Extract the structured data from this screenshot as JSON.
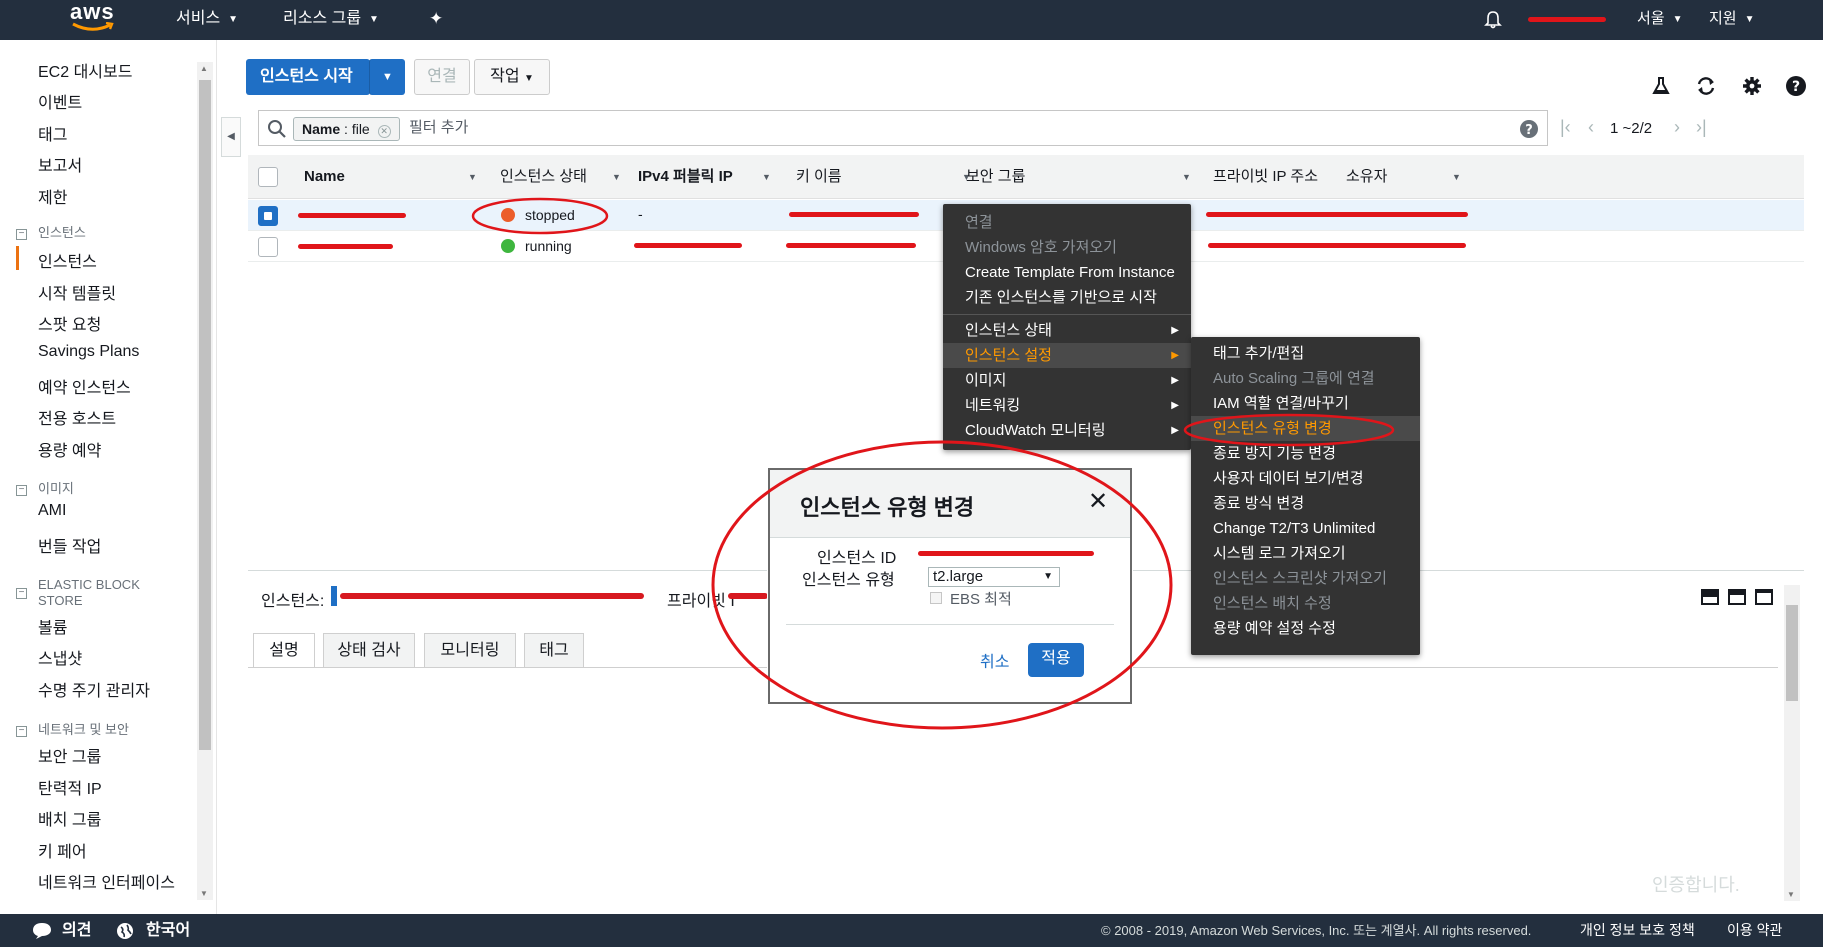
{
  "topnav": {
    "logo": "aws",
    "services": "서비스",
    "resource_groups": "리소스 그룹",
    "region": "서울",
    "support": "지원"
  },
  "sidebar": {
    "items_top": [
      "EC2 대시보드",
      "이벤트",
      "태그",
      "보고서",
      "제한"
    ],
    "sections": [
      {
        "title": "인스턴스",
        "items": [
          "인스턴스",
          "시작 템플릿",
          "스팟 요청",
          "Savings Plans",
          "예약 인스턴스",
          "전용 호스트",
          "용량 예약"
        ]
      },
      {
        "title": "이미지",
        "items": [
          "AMI",
          "번들 작업"
        ]
      },
      {
        "title": "ELASTIC BLOCK STORE",
        "title_line1": "ELASTIC BLOCK",
        "title_line2": "STORE",
        "items": [
          "볼륨",
          "스냅샷",
          "수명 주기 관리자"
        ]
      },
      {
        "title": "네트워크 및 보안",
        "items": [
          "보안 그룹",
          "탄력적 IP",
          "배치 그룹",
          "키 페어",
          "네트워크 인터페이스"
        ]
      }
    ],
    "active": "인스턴스"
  },
  "toolbar": {
    "launch_label": "인스턴스 시작",
    "connect_label": "연결",
    "actions_label": "작업"
  },
  "filter": {
    "chip_key": "Name",
    "chip_value": "file",
    "placeholder": "필터 추가",
    "pagination": "1 ~2/2"
  },
  "table": {
    "columns": [
      "Name",
      "인스턴스 상태",
      "IPv4 퍼블릭 IP",
      "키 이름",
      "보안 그룹",
      "프라이빗 IP 주소",
      "소유자"
    ],
    "rows": [
      {
        "state": "stopped",
        "state_color": "#ec5d2a",
        "ipv4": "-",
        "selected": true
      },
      {
        "state": "running",
        "state_color": "#3eb63e",
        "ipv4": "",
        "selected": false
      }
    ]
  },
  "context_menu": {
    "items": [
      {
        "label": "연결",
        "disabled": true
      },
      {
        "label": "Windows 암호 가져오기",
        "disabled": true
      },
      {
        "label": "Create Template From Instance",
        "disabled": false
      },
      {
        "label": "기존 인스턴스를 기반으로 시작",
        "disabled": false
      },
      {
        "label": "인스턴스 상태",
        "disabled": false,
        "submenu": true
      },
      {
        "label": "인스턴스 설정",
        "disabled": false,
        "submenu": true,
        "highlighted": true
      },
      {
        "label": "이미지",
        "disabled": false,
        "submenu": true
      },
      {
        "label": "네트워킹",
        "disabled": false,
        "submenu": true
      },
      {
        "label": "CloudWatch 모니터링",
        "disabled": false,
        "submenu": true
      }
    ]
  },
  "submenu": {
    "items": [
      {
        "label": "태그 추가/편집",
        "disabled": false
      },
      {
        "label": "Auto Scaling 그룹에 연결",
        "disabled": true
      },
      {
        "label": "IAM 역할 연결/바꾸기",
        "disabled": false
      },
      {
        "label": "인스턴스 유형 변경",
        "disabled": false,
        "highlighted": true
      },
      {
        "label": "종료 방지 기능 변경",
        "disabled": false
      },
      {
        "label": "사용자 데이터 보기/변경",
        "disabled": false
      },
      {
        "label": "종료 방식 변경",
        "disabled": false
      },
      {
        "label": "Change T2/T3 Unlimited",
        "disabled": false
      },
      {
        "label": "시스템 로그 가져오기",
        "disabled": false
      },
      {
        "label": "인스턴스 스크린샷 가져오기",
        "disabled": true
      },
      {
        "label": "인스턴스 배치 수정",
        "disabled": true
      },
      {
        "label": "용량 예약 설정 수정",
        "disabled": false
      }
    ]
  },
  "modal": {
    "title": "인스턴스 유형 변경",
    "instance_id_label": "인스턴스 ID",
    "instance_type_label": "인스턴스 유형",
    "instance_type_value": "t2.large",
    "ebs_label": "EBS 최적",
    "cancel_label": "취소",
    "apply_label": "적용"
  },
  "detail": {
    "instance_label": "인스턴스:",
    "private_label": "프라이빗 I",
    "tabs": [
      "설명",
      "상태 검사",
      "모니터링",
      "태그"
    ],
    "watermark": "인증합니다."
  },
  "footer": {
    "feedback": "의견",
    "language": "한국어",
    "copyright": "© 2008 - 2019, Amazon Web Services, Inc. 또는 계열사. All rights reserved.",
    "privacy": "개인 정보 보호 정책",
    "terms": "이용 약관"
  },
  "colors": {
    "nav": "#232f3e",
    "primary": "#1f6fc5",
    "accent": "#ff9900",
    "annotation": "#e0151a"
  }
}
